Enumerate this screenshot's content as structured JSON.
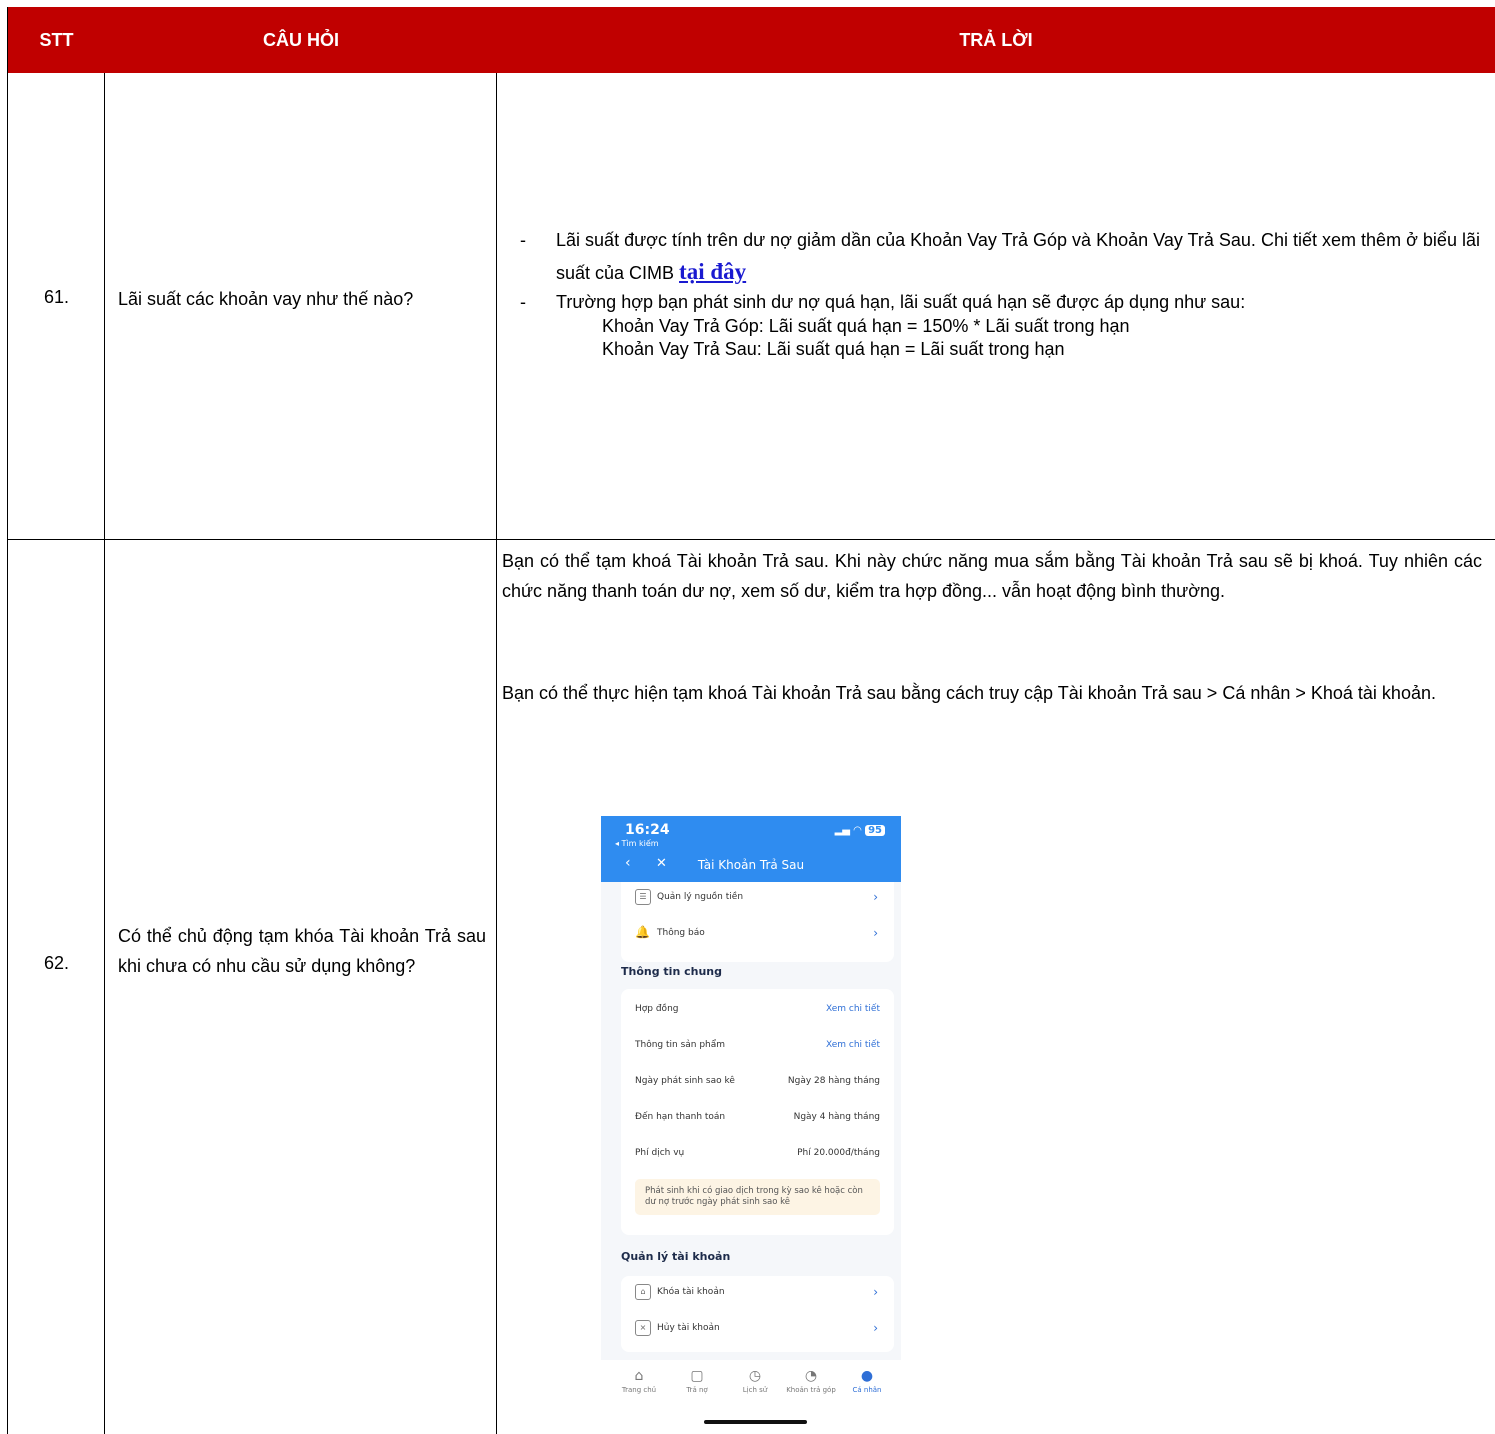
{
  "table": {
    "headers": {
      "stt": "STT",
      "question": "CÂU HỎI",
      "answer": "TRẢ LỜI"
    },
    "rows": [
      {
        "stt": "61.",
        "question": "Lãi suất các khoản vay như thế nào?",
        "answer": {
          "bullets": [
            {
              "dash": "-",
              "text": "Lãi suất được tính trên dư nợ giảm dần của Khoản Vay Trả Góp và Khoản Vay Trả Sau. Chi tiết xem thêm ở biểu lãi suất của CIMB ",
              "link": "tại đây"
            },
            {
              "dash": "-",
              "text": "Trường hợp bạn phát sinh dư nợ quá hạn, lãi suất quá hạn sẽ được áp dụng như sau:",
              "sub": [
                "Khoản Vay Trả Góp: Lãi suất quá hạn = 150% * Lãi suất trong hạn",
                "Khoản Vay Trả Sau: Lãi suất quá hạn = Lãi suất trong hạn"
              ]
            }
          ]
        }
      },
      {
        "stt": "62.",
        "question": "Có thể chủ động tạm khóa Tài khoản Trả sau khi chưa có nhu cầu sử dụng không?",
        "answer": {
          "para1": "Bạn có thể tạm khoá Tài khoản Trả sau. Khi này chức năng mua sắm bằng Tài khoản Trả sau sẽ bị khoá. Tuy nhiên các chức năng thanh toán dư nợ, xem số dư, kiểm tra hợp đồng... vẫn hoạt động bình thường.",
          "para2": "Bạn có thể thực hiện tạm khoá Tài khoản Trả sau bằng cách truy cập Tài khoản Trả sau > Cá nhân > Khoá tài khoản."
        }
      }
    ]
  },
  "phone": {
    "time": "16:24",
    "back_search": "◂ Tìm kiếm",
    "battery": "95",
    "title": "Tài Khoản Trả Sau",
    "menu_top": [
      {
        "icon": "wallet-icon",
        "label": "Quản lý nguồn tiền"
      },
      {
        "icon": "bell-icon",
        "label": "Thông báo"
      }
    ],
    "general_title": "Thông tin chung",
    "general_rows": [
      {
        "label": "Hợp đồng",
        "value": "Xem chi tiết"
      },
      {
        "label": "Thông tin sản phẩm",
        "value": "Xem chi tiết"
      },
      {
        "label": "Ngày phát sinh sao kê",
        "value": "Ngày 28 hàng tháng"
      },
      {
        "label": "Đến hạn thanh toán",
        "value": "Ngày 4 hàng tháng"
      },
      {
        "label": "Phí dịch vụ",
        "value": "Phí 20.000đ/tháng"
      }
    ],
    "notice": "Phát sinh khi có giao dịch trong kỳ sao kê hoặc còn dư nợ trước ngày phát sinh sao kê",
    "account_title": "Quản lý tài khoản",
    "account_rows": [
      {
        "icon": "lock-icon",
        "label": "Khóa tài khoản"
      },
      {
        "icon": "cancel-icon",
        "label": "Hủy tài khoản"
      }
    ],
    "tabs": [
      {
        "icon": "home-icon",
        "label": "Trang chủ"
      },
      {
        "icon": "receipt-icon",
        "label": "Trả nợ"
      },
      {
        "icon": "clock-icon",
        "label": "Lịch sử"
      },
      {
        "icon": "pie-icon",
        "label": "Khoản trả góp"
      },
      {
        "icon": "user-icon",
        "label": "Cá nhân"
      }
    ]
  },
  "colors": {
    "header_bg": "#c00000",
    "link": "#1a1ad0",
    "app_blue": "#2f8cf0"
  }
}
